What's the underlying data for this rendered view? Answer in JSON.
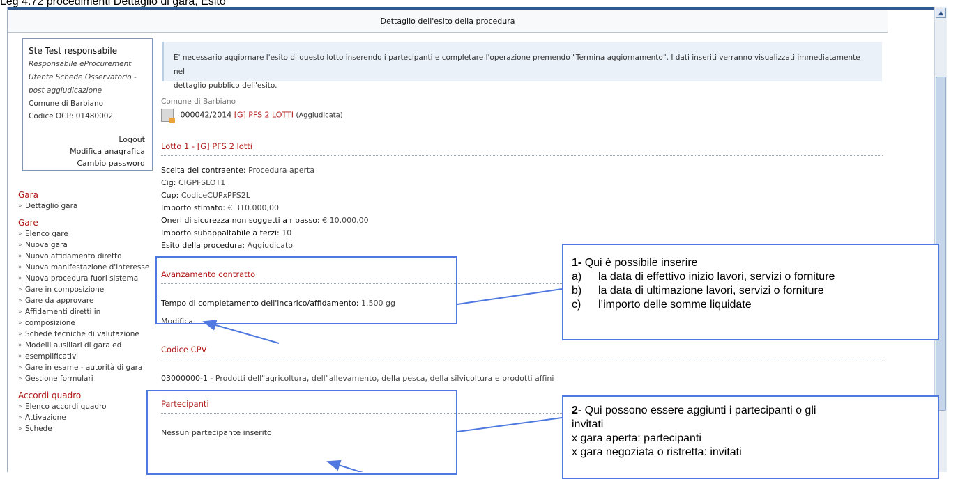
{
  "doc_caption": "Leg 4.72 procedimenti Dettaglio di gara, Esito",
  "page_title": "Dettaglio dell'esito della procedura",
  "user": {
    "name": "Ste Test responsabile",
    "role1": "Responsabile eProcurement",
    "role2": "Utente Schede Osservatorio -",
    "role3": "post aggiudicazione",
    "ente": "Comune di Barbiano",
    "ocp": "Codice OCP: 01480002",
    "logout": "Logout",
    "modifica_anagrafica": "Modifica anagrafica",
    "cambio_password": "Cambio password"
  },
  "nav": {
    "gara_title": "Gara",
    "gara_items": [
      "Dettaglio gara"
    ],
    "gare_title": "Gare",
    "gare_items": [
      "Elenco gare",
      "Nuova gara",
      "Nuovo affidamento diretto",
      "Nuova manifestazione d'interesse",
      "Nuova procedura fuori sistema",
      "Gare in composizione",
      "Gare da approvare",
      "Affidamenti diretti in",
      "composizione",
      "Schede tecniche di valutazione",
      "Modelli ausiliari di gara ed",
      "esemplificativi",
      "Gare in esame - autorità di gara",
      "Gestione formulari"
    ],
    "accordi_title": "Accordi quadro",
    "accordi_items": [
      "Elenco accordi quadro",
      "Attivazione",
      "Schede"
    ]
  },
  "notice": {
    "line1": "E' necessario aggiornare l'esito di questo lotto inserendo i partecipanti e completare l'operazione premendo \"Termina aggiornamento\". I dati inseriti verranno visualizzati immediatamente nel",
    "line2": "dettaglio pubblico dell'esito."
  },
  "procedure": {
    "ente": "Comune di Barbiano",
    "code": "000042/2014",
    "title": "[G] PFS 2 LOTTI",
    "status": "(Aggiudicata)"
  },
  "lotto": {
    "heading": "Lotto 1 - [G] PFS 2 lotti",
    "scelta_label": "Scelta del contraente:",
    "scelta_value": "Procedura aperta",
    "cig_label": "Cig:",
    "cig_value": "CIGPFSLOT1",
    "cup_label": "Cup:",
    "cup_value": "CodiceCUPxPFS2L",
    "importo_label": "Importo stimato:",
    "importo_value": "€ 310.000,00",
    "oneri_label": "Oneri di sicurezza non soggetti a ribasso:",
    "oneri_value": "€ 10.000,00",
    "subappalto_label": "Importo subappaltabile a terzi:",
    "subappalto_value": "10",
    "esito_label": "Esito della procedura:",
    "esito_value": "Aggiudicato"
  },
  "avanzamento": {
    "heading": "Avanzamento contratto",
    "tempo_label": "Tempo di completamento dell'incarico/affidamento:",
    "tempo_value": "1.500 gg",
    "modifica": "Modifica"
  },
  "cpv": {
    "heading": "Codice CPV",
    "code": "03000000-1",
    "desc": "- Prodotti dell\"agricoltura, dell\"allevamento, della pesca, della silvicoltura e prodotti affini"
  },
  "partecipanti": {
    "heading": "Partecipanti",
    "empty": "Nessun partecipante inserito"
  },
  "callout1": {
    "num": "1-",
    "intro": "Qui è possibile inserire",
    "items": [
      {
        "letter": "a)",
        "text": "la data di effettivo inizio lavori, servizi o forniture"
      },
      {
        "letter": "b)",
        "text": "la data di ultimazione lavori, servizi o forniture"
      },
      {
        "letter": "c)",
        "text": "l’importo delle somme liquidate"
      }
    ]
  },
  "callout2": {
    "num": "2",
    "line1": "- Qui possono essere aggiunti i partecipanti  o gli",
    "line2": "invitati",
    "line3": "x gara aperta: partecipanti",
    "line4": "x gara  negoziata o ristretta: invitati"
  },
  "colors": {
    "accent": "#b01818",
    "callout_border": "#4f79e0",
    "topbar": "#2f5a96"
  }
}
